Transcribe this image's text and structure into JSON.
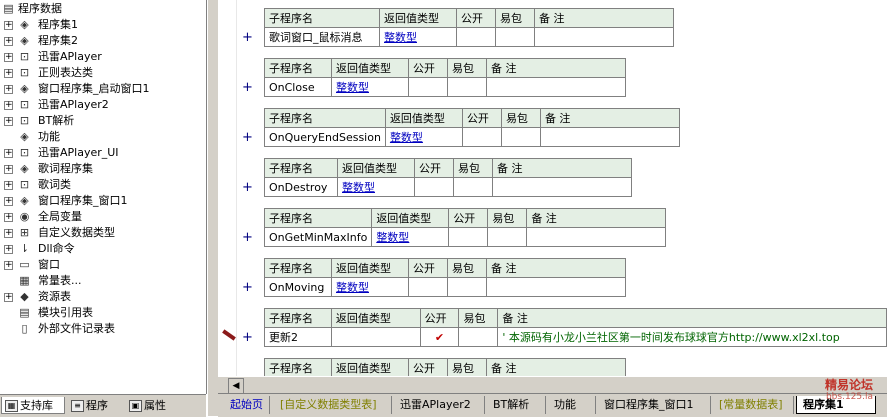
{
  "tree": {
    "root": "程序数据",
    "items": [
      {
        "label": "程序集1",
        "icon": "module-icon",
        "toggle": "+"
      },
      {
        "label": "程序集2",
        "icon": "module-icon",
        "toggle": "+"
      },
      {
        "label": "迅雷APlayer",
        "icon": "class-icon",
        "toggle": "+"
      },
      {
        "label": "正则表达类",
        "icon": "class-icon",
        "toggle": "+"
      },
      {
        "label": "窗口程序集_启动窗口1",
        "icon": "module-icon",
        "toggle": "+"
      },
      {
        "label": "迅雷APlayer2",
        "icon": "class-icon",
        "toggle": "+"
      },
      {
        "label": "BT解析",
        "icon": "class-icon",
        "toggle": "+"
      },
      {
        "label": "功能",
        "icon": "module-icon",
        "toggle": ""
      },
      {
        "label": "迅雷APlayer_UI",
        "icon": "class-icon",
        "toggle": "+"
      },
      {
        "label": "歌词程序集",
        "icon": "module-icon",
        "toggle": "+"
      },
      {
        "label": "歌词类",
        "icon": "class-icon",
        "toggle": "+"
      },
      {
        "label": "窗口程序集_窗口1",
        "icon": "module-icon",
        "toggle": "+"
      },
      {
        "label": "全局变量",
        "icon": "global-var-icon",
        "toggle": "+"
      },
      {
        "label": "自定义数据类型",
        "icon": "datatype-icon",
        "toggle": "+"
      },
      {
        "label": "Dll命令",
        "icon": "dll-icon",
        "toggle": "+"
      },
      {
        "label": "窗口",
        "icon": "window-icon",
        "toggle": "+"
      },
      {
        "label": "常量表...",
        "icon": "constant-icon",
        "toggle": ""
      },
      {
        "label": "资源表",
        "icon": "resource-icon",
        "toggle": "+"
      },
      {
        "label": "模块引用表",
        "icon": "module-ref-icon",
        "toggle": ""
      },
      {
        "label": "外部文件记录表",
        "icon": "file-record-icon",
        "toggle": ""
      }
    ]
  },
  "left_tabs": [
    "支持库",
    "程序",
    "属性"
  ],
  "headers": {
    "name": "子程序名",
    "rettype": "返回值类型",
    "public": "公开",
    "easy": "易包",
    "remark": "备 注"
  },
  "procs": [
    {
      "name": "歌词窗口_鼠标消息",
      "rettype": "整数型",
      "public": "",
      "remark": ""
    },
    {
      "name": "OnClose",
      "rettype": "整数型",
      "public": "",
      "remark": ""
    },
    {
      "name": "OnQueryEndSession",
      "rettype": "整数型",
      "public": "",
      "remark": ""
    },
    {
      "name": "OnDestroy",
      "rettype": "整数型",
      "public": "",
      "remark": ""
    },
    {
      "name": "OnGetMinMaxInfo",
      "rettype": "整数型",
      "public": "",
      "remark": ""
    },
    {
      "name": "OnMoving",
      "rettype": "整数型",
      "public": "",
      "remark": ""
    },
    {
      "name": "更新2",
      "rettype": "",
      "public": "✔",
      "remark": "' 本源码有小龙小兰社区第一时间发布球球官方http://www.xl2xl.top"
    },
    {
      "name": "",
      "rettype": "",
      "public": "",
      "remark": ""
    }
  ],
  "bottom_tabs": [
    {
      "label": "起始页",
      "style": "blue"
    },
    {
      "label": "[自定义数据类型表]",
      "style": "olive"
    },
    {
      "label": "迅雷APlayer2",
      "style": ""
    },
    {
      "label": "BT解析",
      "style": ""
    },
    {
      "label": "功能",
      "style": ""
    },
    {
      "label": "窗口程序集_窗口1",
      "style": ""
    },
    {
      "label": "[常量数据表]",
      "style": "olive"
    },
    {
      "label": "程序集1",
      "style": "active"
    }
  ],
  "watermark": {
    "line1": "精易论坛",
    "line2": "bbs.125.la"
  }
}
